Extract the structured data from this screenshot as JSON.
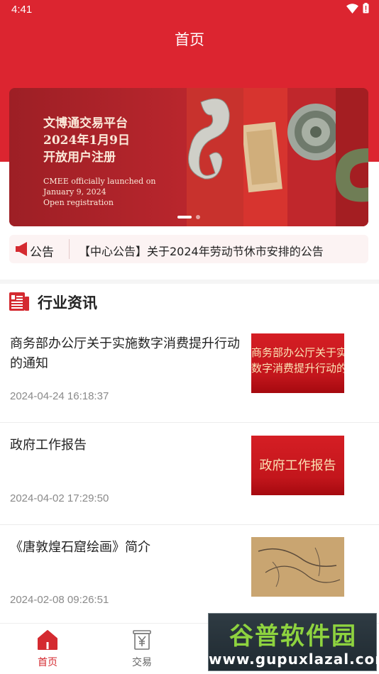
{
  "status_bar": {
    "time": "4:41",
    "wifi_icon": "wifi-icon",
    "battery_icon": "battery-icon"
  },
  "header": {
    "title": "首页"
  },
  "banner": {
    "cn_line1": "文博通交易平台",
    "cn_line2": "2024年1月9日",
    "cn_line3": "开放用户注册",
    "en_line1": "CMEE officially launched on",
    "en_line2": "January 9, 2024",
    "en_line3": "Open registration",
    "active_slide": 1,
    "total_slides": 2
  },
  "notice": {
    "icon": "megaphone-icon",
    "label": "公告",
    "text": "【中心公告】关于2024年劳动节休市安排的公告"
  },
  "section": {
    "icon": "news-icon",
    "title": "行业资讯"
  },
  "news": [
    {
      "title": "商务部办公厅关于实施数字消费提升行动的通知",
      "date": "2024-04-24 16:18:37",
      "thumb_line1": "商务部办公厅关于实施",
      "thumb_line2": "数字消费提升行动的通知"
    },
    {
      "title": "政府工作报告",
      "date": "2024-04-02 17:29:50",
      "thumb_line1": "政府工作报告"
    },
    {
      "title": "《唐敦煌石窟绘画》简介",
      "date": "2024-02-08 09:26:51"
    }
  ],
  "tabbar": {
    "items": [
      {
        "label": "首页",
        "icon": "home-icon",
        "active": true
      },
      {
        "label": "交易",
        "icon": "yen-receipt-icon",
        "active": false
      }
    ]
  },
  "watermark": {
    "line1": "谷普软件园",
    "line2": "www.gupuxlazal.com"
  },
  "colors": {
    "brand_red": "#dc2530",
    "accent_red": "#d42a30"
  }
}
